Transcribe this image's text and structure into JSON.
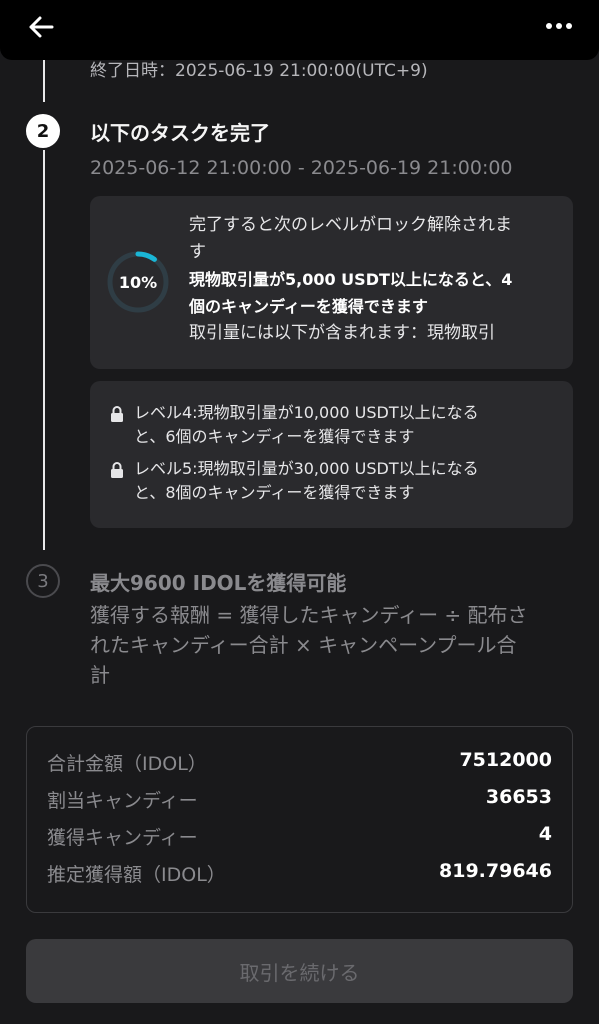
{
  "header": {
    "back_icon": "arrow-left-icon",
    "more_icon": "more-horizontal-icon"
  },
  "step1": {
    "end_time": "終了日時：2025-06-19 21:00:00(UTC+9)"
  },
  "step2": {
    "number": "2",
    "title": "以下のタスクを完了",
    "date_range": "2025-06-12 21:00:00 - 2025-06-19 21:00:00",
    "progress": {
      "percent_label": "10%",
      "fraction": 0.1,
      "line1": "完了すると次のレベルがロック解除されま",
      "line1b": "す",
      "bold_line1": "現物取引量が5,000 USDT以上になると、4",
      "bold_line2": "個のキャンディーを獲得できます",
      "line_includes": "取引量には以下が含まれます：現物取引"
    },
    "locked_levels": [
      {
        "line1": "レベル4:現物取引量が10,000 USDT以上になる",
        "line2": "と、6個のキャンディーを獲得できます"
      },
      {
        "line1": "レベル5:現物取引量が30,000 USDT以上になる",
        "line2": "と、8個のキャンディーを獲得できます"
      }
    ]
  },
  "step3": {
    "number": "3",
    "title": "最大9600 IDOLを獲得可能",
    "desc_line1": "獲得する報酬 = 獲得したキャンディー ÷ 配布さ",
    "desc_line2": "れたキャンディー合計 × キャンペーンプール合",
    "desc_line3": "計"
  },
  "summary": [
    {
      "label": "合計金額（IDOL）",
      "value": "7512000"
    },
    {
      "label": "割当キャンディー",
      "value": "36653"
    },
    {
      "label": "獲得キャンディー",
      "value": "4"
    },
    {
      "label": "推定獲得額（IDOL）",
      "value": "819.79646"
    }
  ],
  "cta": {
    "label": "取引を続ける"
  },
  "colors": {
    "ring_track": "#2f3d45",
    "ring_fill": "#1ab6d6",
    "background": "#19191b",
    "card": "#2a2a2d"
  }
}
